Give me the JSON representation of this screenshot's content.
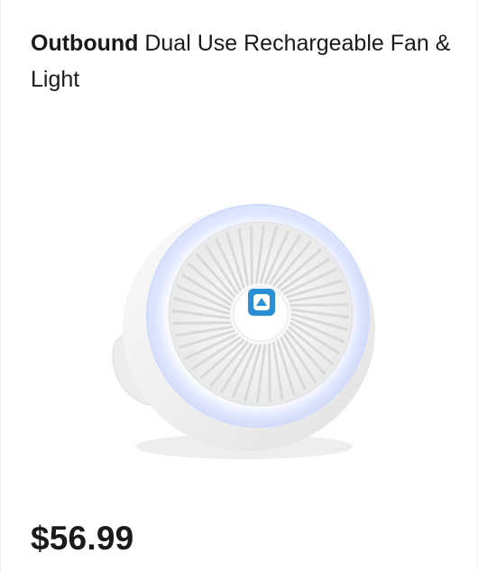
{
  "product": {
    "brand": "Outbound",
    "name": " Dual Use Rechargeable Fan & Light",
    "price": "$56.99",
    "image": {
      "subject": "fan-light-product-image"
    }
  },
  "colors": {
    "text": "#1a1a1a",
    "accent_blue": "#2b8fd6",
    "fan_white": "#f4f4f4",
    "ring_glow": "#e6ecff"
  }
}
